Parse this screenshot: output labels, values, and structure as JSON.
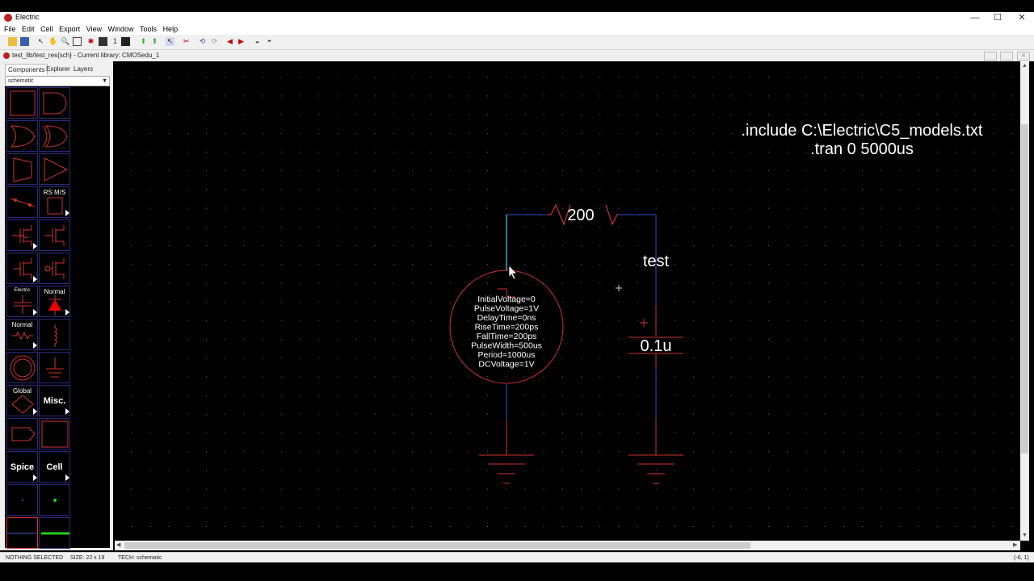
{
  "window": {
    "title": "Electric",
    "minimize": "—",
    "maximize": "☐",
    "close": "✕"
  },
  "menu": [
    "File",
    "Edit",
    "Cell",
    "Export",
    "View",
    "Window",
    "Tools",
    "Help"
  ],
  "toolbar": {
    "grid_scale": "1"
  },
  "document": {
    "title": "test_lib/test_res{sch} - Current library: CMOSedu_1"
  },
  "side_panel": {
    "tabs": [
      "Components",
      "Explorer",
      "Layers"
    ],
    "technology": "schematic",
    "palette_labels": {
      "rs_ms": "RS M/S",
      "electric": "Electric",
      "normal_1": "Normal",
      "normal_2": "Normal",
      "global": "Global",
      "misc": "Misc.",
      "spice": "Spice",
      "cell": "Cell"
    }
  },
  "schematic": {
    "spice_lines": [
      ".include C:\\Electric\\C5_models.txt",
      ".tran 0 5000us"
    ],
    "resistor_value": "200",
    "net_label": "test",
    "capacitor_value": "0.1u",
    "source_params": [
      "InitialVoltage=0",
      "PulseVoltage=1V",
      "DelayTime=0ns",
      "RiseTime=200ps",
      "FallTime=200ps",
      "PulseWidth=500us",
      "Period=1000us",
      "DCVoltage=1V"
    ]
  },
  "status": {
    "selection": "NOTHING SELECTED",
    "size": "SIZE: 22 x 19",
    "tech": "TECH: schematic",
    "coords": "(-6, 1)"
  }
}
